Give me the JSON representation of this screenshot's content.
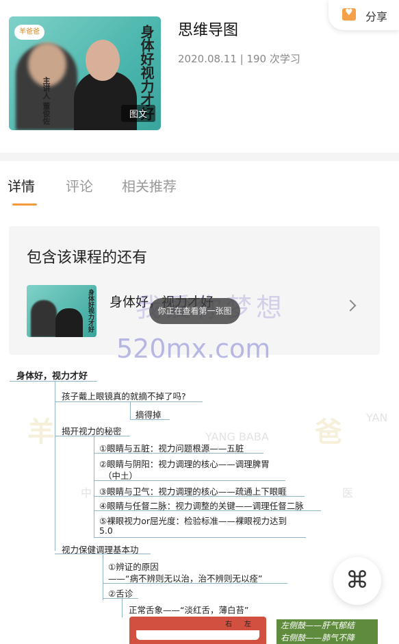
{
  "header": {
    "cover_tag": "图文",
    "cover_title": "身体好视力才好",
    "cover_logo": "羊爸爸",
    "cover_teacher": "主讲人 董俊佐",
    "title": "思维导图",
    "meta": "2020.08.11 | 190 次学习"
  },
  "share": {
    "label": "分享",
    "icon": "heart-bag-icon"
  },
  "tabs": [
    {
      "label": "详情",
      "active": true
    },
    {
      "label": "评论",
      "active": false
    },
    {
      "label": "相关推荐",
      "active": false
    }
  ],
  "related": {
    "title": "包含该课程的还有",
    "course_name": "身体好，视力才好",
    "thumb_title": "身体好视力才好"
  },
  "toast": "你正在查看第一张图",
  "watermark": {
    "line1": "我爱你梦想",
    "line2": "520mx.com"
  },
  "mindmap": {
    "root": "身体好，视力才好",
    "q1": "孩子戴上眼镜真的就摘不掉了吗?",
    "q1_a": "摘得掉",
    "sec2": "揭开视力的秘密",
    "sec2_items": [
      "①眼睛与五脏：视力问题根源——五脏",
      "②眼睛与阴阳：视力调理的核心——调理脾胃",
      "（中土）",
      "③眼睛与卫气：视力调理的核心——疏通上下眼睚",
      "④眼睛与任督二脉：视力调整的关键——调理任督二脉",
      "⑤裸眼视力or屈光度：检验标准——裸眼视力达到",
      "5.0"
    ],
    "sec3": "视力保健调理基本功",
    "sec3_a": "①辨证的原因",
    "sec3_a_quote": "——“病不辨则无以治，治不辨则无以痊”",
    "sec3_b": "②舌诊",
    "sec3_b_item": "正常舌象——“淡红舌，薄白苔”",
    "tongue_labels": [
      "右",
      "左"
    ],
    "green_lines": [
      "左侧鼓——肝气郁结",
      "右侧鼓——肺气不降"
    ],
    "bg_watermarks": [
      "羊",
      "爸",
      "中",
      "医",
      "YANG BABA",
      "YAN"
    ]
  },
  "fab": {
    "icon": "four-petal-menu-icon"
  }
}
